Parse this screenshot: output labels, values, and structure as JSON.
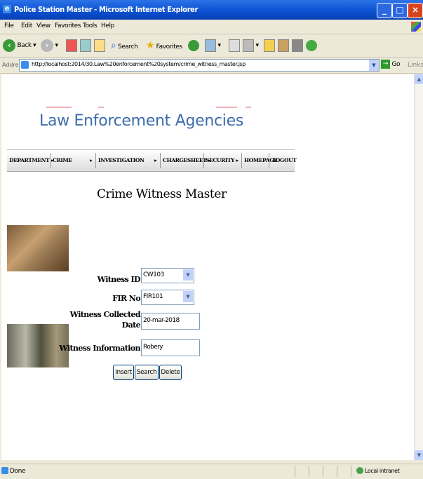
{
  "window": {
    "title": "Police Station Master - Microsoft Internet Explorer"
  },
  "menu": [
    "File",
    "Edit",
    "View",
    "Favorites",
    "Tools",
    "Help"
  ],
  "toolbar": {
    "back": "Back",
    "search": "Search",
    "favorites": "Favorites"
  },
  "address": {
    "label": "Address",
    "url": "http://localhost:2014/30.Law%20enforcement%20system/crime_witness_master.jsp",
    "go": "Go",
    "links": "Links"
  },
  "banner": {
    "title": "Law Enforcement Agencies"
  },
  "nav": [
    "DEPARTMENT",
    "CRIME",
    "INVESTIGATION",
    "CHARGESHEET",
    "SECURITY",
    "HOMEPAGE",
    "LOGOUT"
  ],
  "page": {
    "title": "Crime Witness Master"
  },
  "form": {
    "witness_id_label": "Witness ID",
    "witness_id_value": "CW103",
    "fir_label": "FIR No",
    "fir_value": "FIR101",
    "collected_label_1": "Witness Collected",
    "collected_label_2": "Date",
    "collected_value": "20-mar-2018",
    "info_label": "Witness Information",
    "info_value": "Robery",
    "insert": "Insert",
    "search": "Search",
    "delete": "Delete"
  },
  "status": {
    "text": "Done",
    "zone": "Local intranet"
  },
  "colors": {
    "titlebar": "#0a4fd0",
    "banner_text": "#3d6cab",
    "chrome": "#ece9d8"
  }
}
